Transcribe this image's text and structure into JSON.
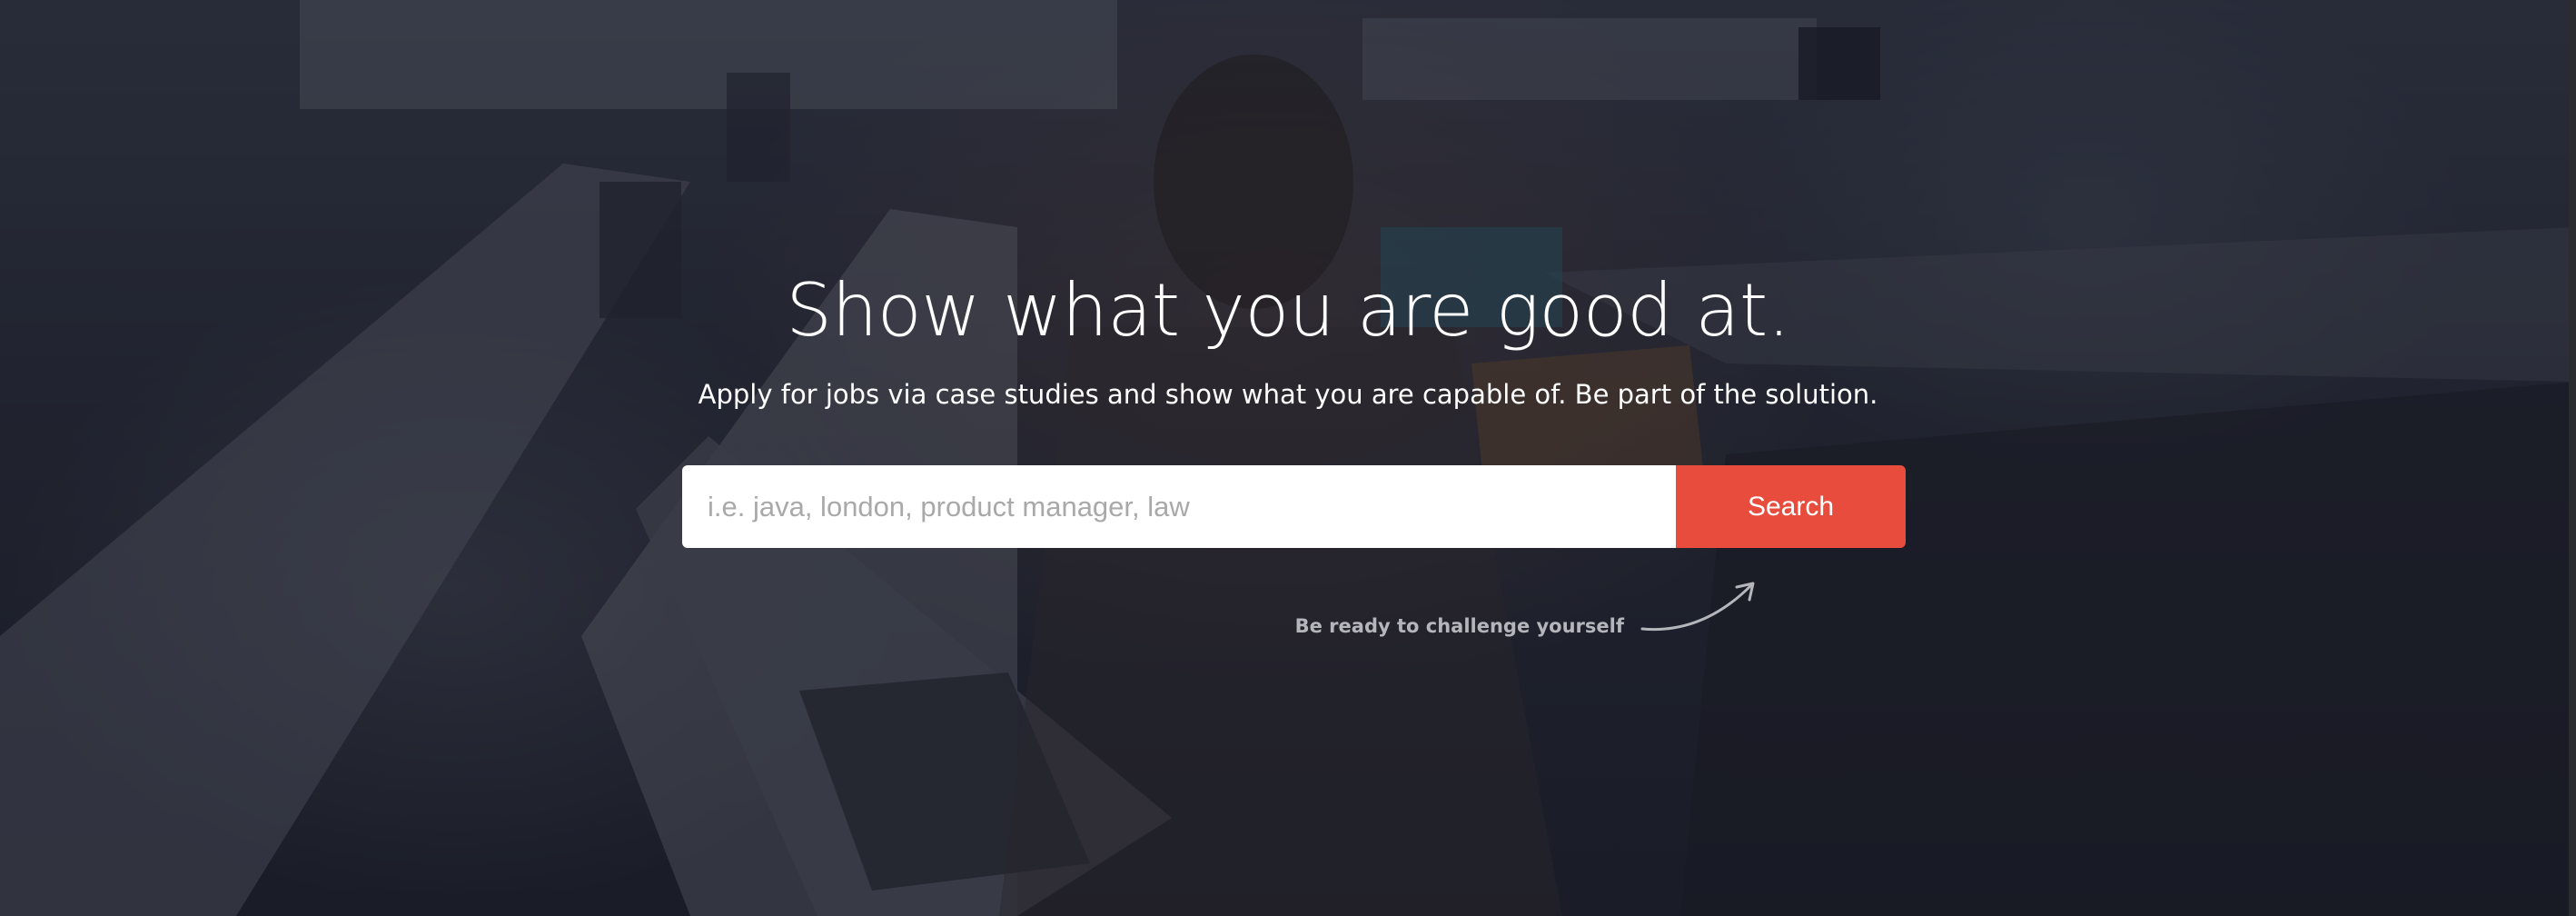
{
  "hero": {
    "headline": "Show what you are good at.",
    "subheadline": "Apply for jobs via case studies and show what you are capable of. Be part of the solution.",
    "overlay_color": "#141622"
  },
  "search": {
    "placeholder": "i.e. java, london, product manager, law",
    "value": "",
    "button_label": "Search",
    "button_color": "#e84c3d"
  },
  "hint": {
    "text": "Be ready to challenge yourself",
    "icon": "curved-arrow-icon"
  }
}
